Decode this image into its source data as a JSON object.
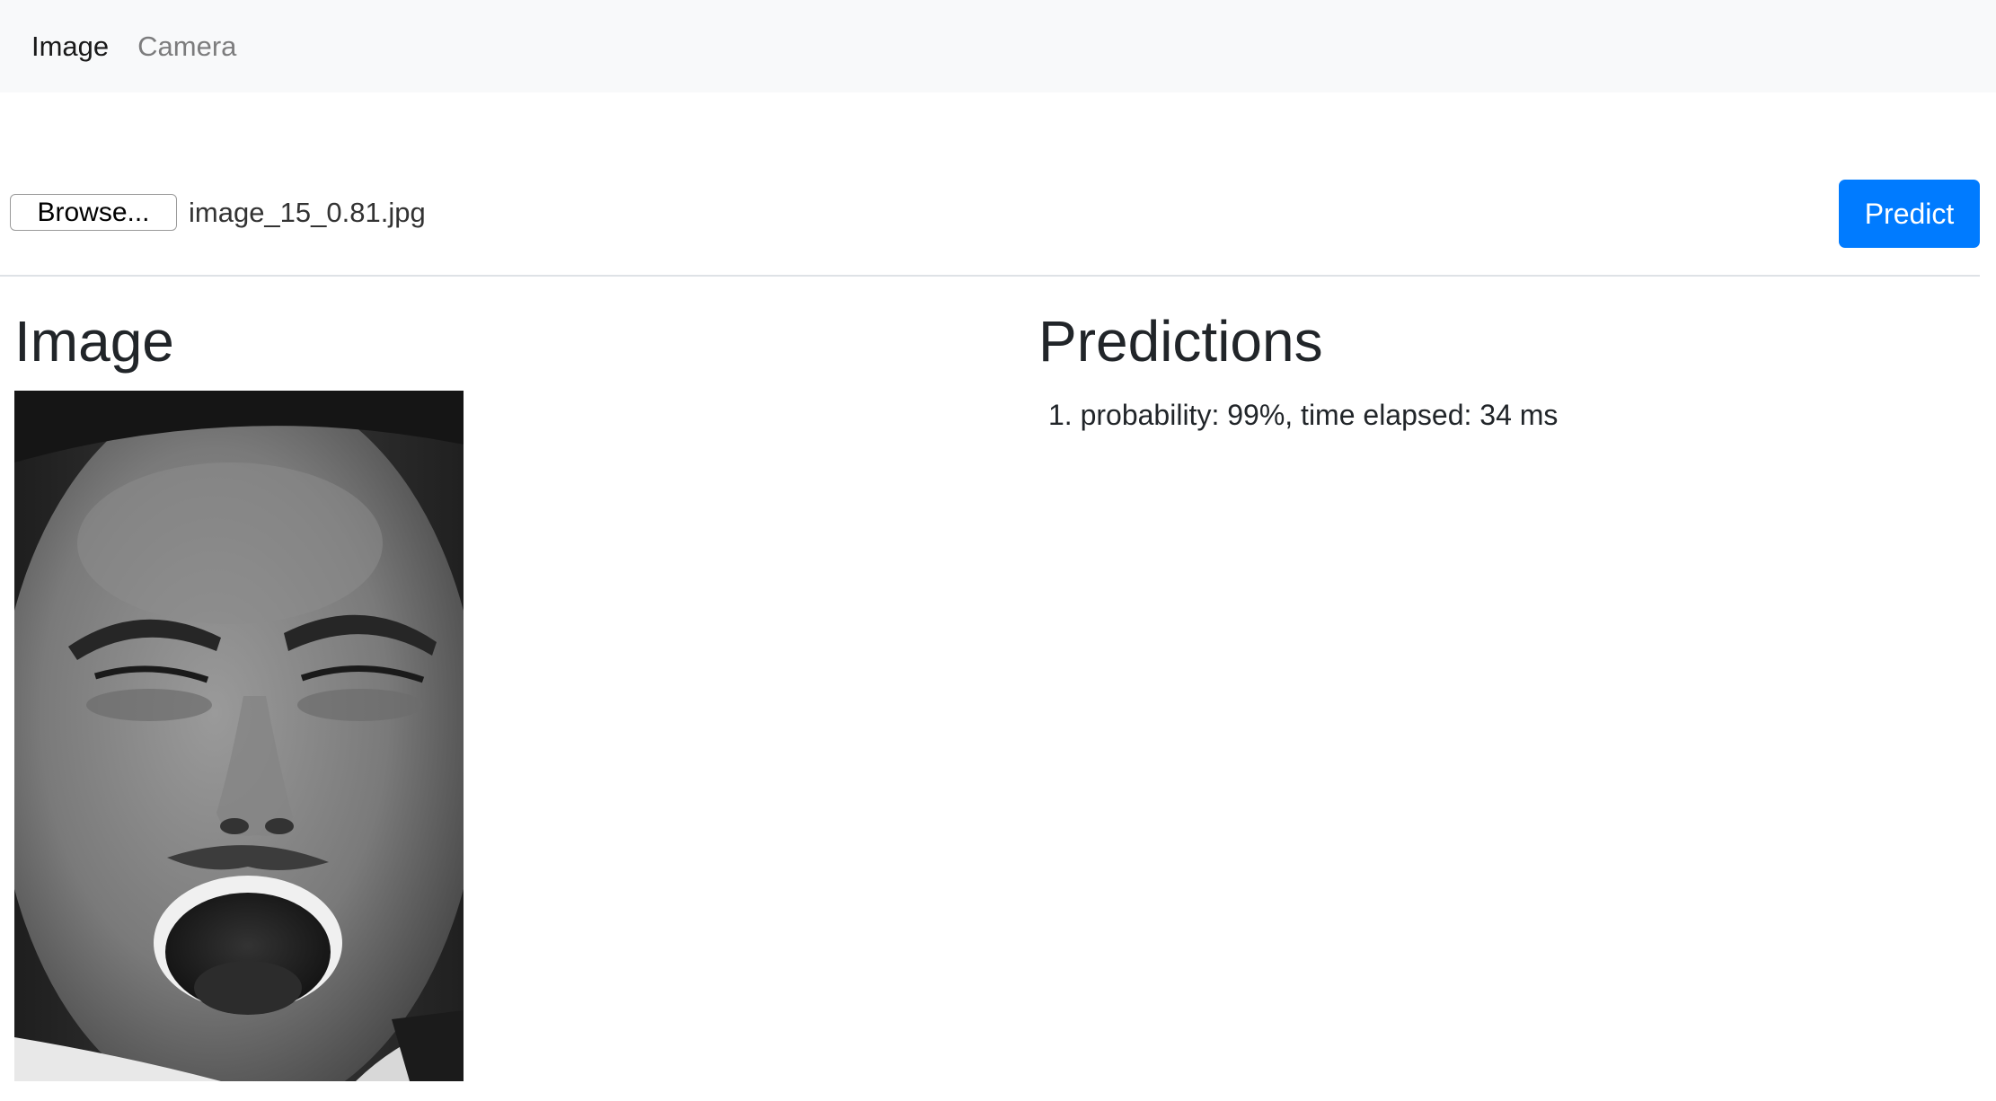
{
  "nav": {
    "items": [
      {
        "label": "Image",
        "active": true
      },
      {
        "label": "Camera",
        "active": false
      }
    ]
  },
  "upload": {
    "browse_label": "Browse...",
    "file_name": "image_15_0.81.jpg",
    "predict_label": "Predict"
  },
  "image_section": {
    "title": "Image"
  },
  "predictions": {
    "title": "Predictions",
    "items": [
      {
        "index": "1.",
        "text": "probability: 99%, time elapsed: 34 ms"
      }
    ]
  },
  "colors": {
    "navbar_bg": "#f8f9fa",
    "primary": "#007bff",
    "divider": "#dee2e6",
    "text": "#212529"
  }
}
